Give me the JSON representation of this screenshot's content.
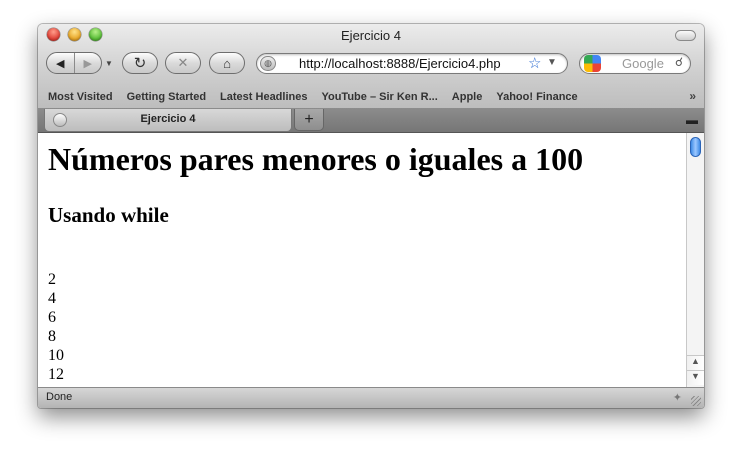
{
  "window": {
    "title": "Ejercicio 4"
  },
  "nav": {
    "back_icon": "◀",
    "forward_icon": "▶",
    "reload_icon": "↻",
    "stop_icon": "✕",
    "home_icon": "⌂",
    "url": "http://localhost:8888/Ejercicio4.php",
    "bookmark_star_icon": "☆"
  },
  "search": {
    "placeholder": "Google",
    "icon": "search-icon"
  },
  "bookmarks": [
    "Most Visited",
    "Getting Started",
    "Latest Headlines",
    "YouTube – Sir Ken R...",
    "Apple",
    "Yahoo! Finance"
  ],
  "tabs": [
    {
      "label": "Ejercicio 4"
    }
  ],
  "page": {
    "heading": "Números pares menores o iguales a 100",
    "subheading": "Usando while",
    "numbers": [
      "2",
      "4",
      "6",
      "8",
      "10",
      "12"
    ]
  },
  "status": {
    "text": "Done"
  },
  "colors": {
    "accent_blue": "#2a6ad0",
    "scroll_thumb": "#3f8be6"
  }
}
